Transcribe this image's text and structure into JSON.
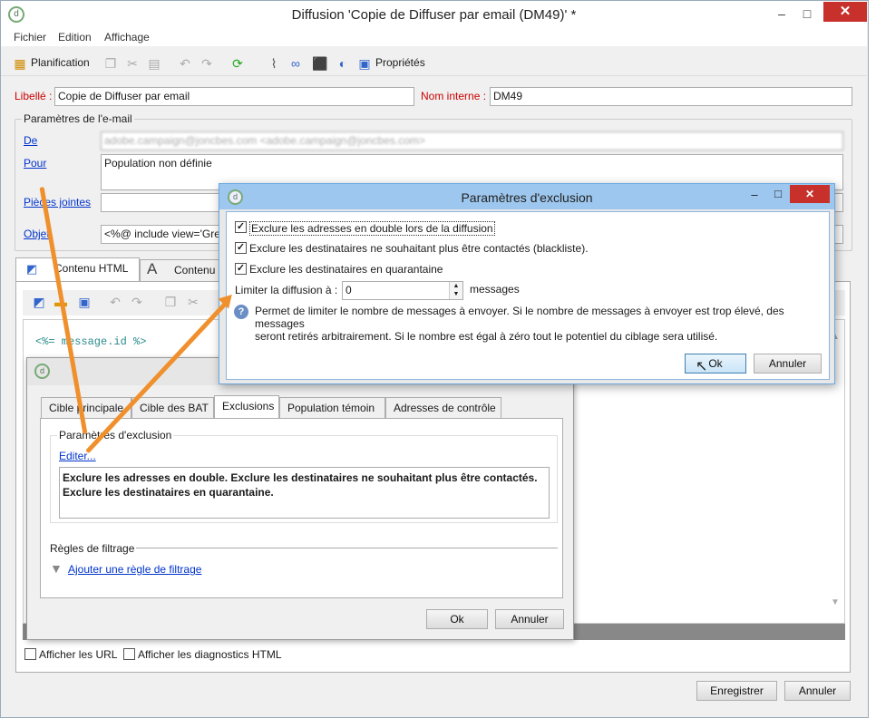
{
  "window": {
    "title": "Diffusion 'Copie de Diffuser par email (DM49)' *",
    "minimize": "–",
    "maximize": "□",
    "close": "✕"
  },
  "menu": [
    "Fichier",
    "Edition",
    "Affichage"
  ],
  "toolbar": {
    "planification": "Planification",
    "proprietes": "Propriétés"
  },
  "form": {
    "libelle_label": "Libellé :",
    "libelle_value": "Copie de Diffuser par email",
    "nom_interne_label": "Nom interne :",
    "nom_interne_value": "DM49",
    "email_params_title": "Paramètres de l'e-mail",
    "de_label": "De",
    "de_value": "adobe.campaign@joncbes.com <adobe.campaign@joncbes.com>",
    "pour_label": "Pour",
    "pour_value": "Population non définie",
    "pieces_label": "Pièces jointes",
    "objet_label": "Objet",
    "objet_value": "<%@ include view='Gre"
  },
  "content_tabs": [
    "Contenu HTML",
    "Contenu t"
  ],
  "editor_text": "<%= message.id %>",
  "inner_dialog": {
    "tabs": [
      "Cible principale",
      "Cible des BAT",
      "Exclusions",
      "Population témoin",
      "Adresses de contrôle"
    ],
    "active_tab": "Exclusions",
    "group_title": "Paramètres d'exclusion",
    "edit_link": "Editer...",
    "summary_line1": "Exclure les adresses en double. Exclure les destinataires ne souhaitant plus être contactés.",
    "summary_line2": "Exclure les destinataires en quarantaine.",
    "rules_title": "Règles de filtrage",
    "add_rule_link": "Ajouter une règle de filtrage",
    "ok": "Ok",
    "cancel": "Annuler"
  },
  "bottom": {
    "show_urls": "Afficher les URL",
    "show_diag": "Afficher les diagnostics HTML",
    "save": "Enregistrer",
    "cancel": "Annuler"
  },
  "exclusion_dialog": {
    "title": "Paramètres d'exclusion",
    "opt1": "Exclure les adresses en double lors de la diffusion",
    "opt2": "Exclure les destinataires ne souhaitant plus être contactés (blackliste).",
    "opt3": "Exclure les destinataires en quarantaine",
    "limit_label": "Limiter la diffusion à :",
    "limit_value": "0",
    "limit_unit": "messages",
    "help_line1": "Permet de limiter le nombre de messages à envoyer. Si le nombre de messages à envoyer est trop élevé, des messages",
    "help_line2": "seront retirés arbitrairement. Si le nombre est égal à zéro tout le potentiel du ciblage sera utilisé.",
    "ok": "Ok",
    "cancel": "Annuler"
  },
  "colors": {
    "accent": "#0033cc",
    "required": "#cc0000",
    "annotation_arrow": "#f0902c",
    "close": "#c7302b"
  }
}
